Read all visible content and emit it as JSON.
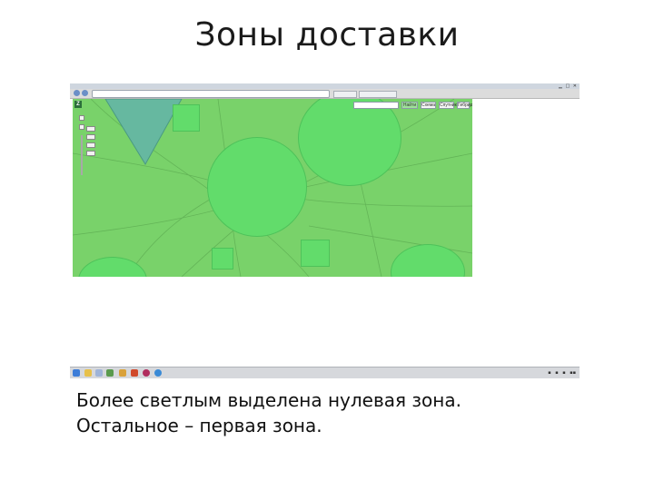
{
  "slide": {
    "title": "Зоны доставки",
    "caption_lines": [
      "Более светлым выделена нулевая зона.",
      "Остальное – первая зона."
    ]
  },
  "map": {
    "controls": {
      "find_label": "Найти",
      "scheme_label": "Схема",
      "satellite_label": "Спутник",
      "hybrid_label": "Гибрид"
    },
    "zone_colors": {
      "zero_zone": "#62dc6b",
      "first_zone": "#79d26a",
      "other_zone": "#66b8a0"
    }
  },
  "icons": {
    "window": [
      "minimize-icon",
      "maximize-icon",
      "close-icon"
    ],
    "map_logo": "map-logo-icon",
    "taskbar": [
      "start-icon",
      "folder-icon",
      "document-icon",
      "network-icon",
      "chart-icon",
      "browser-icon",
      "app-icon",
      "internet-explorer-icon"
    ],
    "tray": [
      "flag-icon",
      "sound-icon",
      "network-tray-icon",
      "clock-icon"
    ]
  }
}
